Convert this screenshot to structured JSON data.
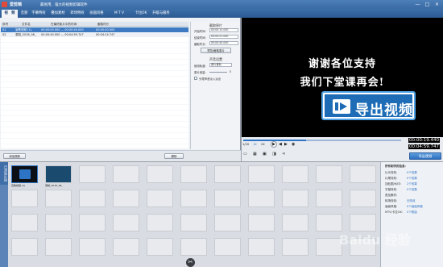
{
  "app": {
    "title": "爱剪辑",
    "slogan": "最易用、强大的视频剪辑软件"
  },
  "window_controls": [
    "—",
    "□",
    "×"
  ],
  "tabs": [
    "视　频",
    "音频",
    "字幕特效",
    "叠加素材",
    "转场特效",
    "画面风格",
    "M T V",
    "卡拉OK",
    "升级与服务"
  ],
  "file_table": {
    "headers": [
      "序号",
      "文件名",
      "在最终影片中的时间",
      "截取时长"
    ],
    "rows": [
      {
        "index": "01",
        "name": "宣教视频 (1).",
        "range": "00:00:00.000 — 00:00:40.000",
        "duration": "00:00:40.000"
      },
      {
        "index": "02",
        "name": "录制_2016_08_",
        "range": "00:00:40.000 — 00:04:59.747",
        "duration": "00:04:14.747"
      }
    ]
  },
  "settings": {
    "clip_title": "截取原片",
    "start_label": "开始时间:",
    "start_value": "00:00:15.000",
    "end_label": "结束时间:",
    "end_value": "00:00:51.000",
    "duration_label": "截取时长:",
    "duration_value": "00:00:40.000",
    "preview_button": "预览/截取原片",
    "audio_title": "声音设置",
    "track_label": "使用轨道:",
    "track_value": "原片音轨",
    "volume_label": "原片音量:",
    "volume_value": "0",
    "checkbox_label": "头尾声音淡入淡出",
    "confirm_button": "确认修改"
  },
  "bottom": {
    "add_video": "添加视频",
    "delete": "删除"
  },
  "preview": {
    "subtitle_line1": "谢谢各位支持",
    "subtitle_line2": "我们下堂课再会!",
    "callout_text": "导出视频",
    "time_current": "00:00:19.440",
    "time_total": "00:04:59.747",
    "export_button": "导出视频",
    "speed_options": [
      "1/2X",
      "1X",
      "2X"
    ]
  },
  "dock": {
    "label": "已添加片段"
  },
  "clips": [
    {
      "label": "宣教视频 (1)"
    },
    {
      "label": "录制_2016_08_"
    }
  ],
  "info_panel": {
    "title": "所有制作的信息:",
    "lines": [
      "片头特效:",
      "片尾特效:",
      "加贴图/水印:",
      "字幕特效:",
      "叠加素材:",
      "转场特效:",
      "画面风格:",
      "MTV/卡拉OK:"
    ],
    "values": [
      "0个效果",
      "0个效果",
      "2个效果",
      "0个效果",
      "无特效",
      "0个画面风格",
      "0个歌曲"
    ]
  },
  "watermark": "Baidu 经验"
}
